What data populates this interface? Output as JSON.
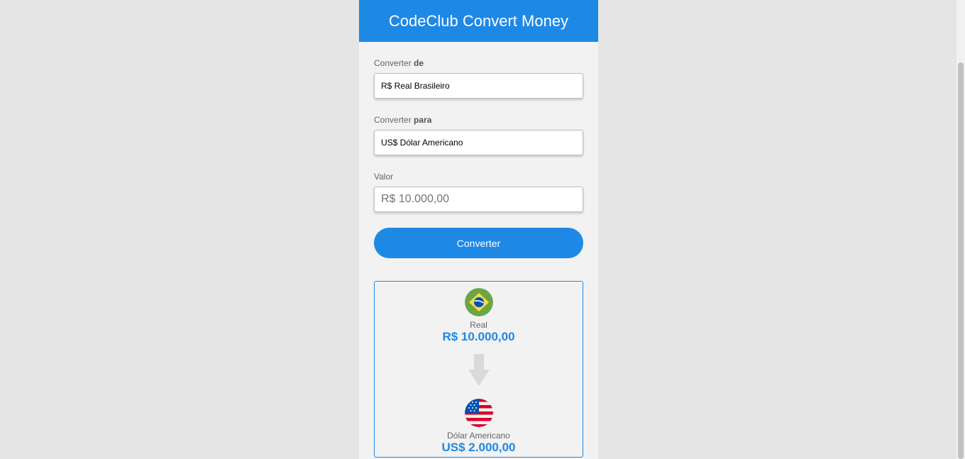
{
  "app": {
    "title": "CodeClub Convert Money"
  },
  "form": {
    "from_label_prefix": "Converter ",
    "from_label_bold": "de",
    "from_selected": "R$ Real Brasileiro",
    "to_label_prefix": "Converter ",
    "to_label_bold": "para",
    "to_selected": "US$ Dólar Americano",
    "value_label": "Valor",
    "value_placeholder": "R$ 10.000,00",
    "convert_label": "Converter"
  },
  "result": {
    "from_flag_icon": "brazil-flag-icon",
    "from_currency_name": "Real",
    "from_amount": "R$ 10.000,00",
    "arrow_icon": "arrow-down-icon",
    "to_flag_icon": "usa-flag-icon",
    "to_currency_name": "Dólar Americano",
    "to_amount": "US$ 2.000,00"
  },
  "colors": {
    "accent": "#1e88e5",
    "background": "#e5e5e5",
    "panel": "#f2f2f2"
  }
}
